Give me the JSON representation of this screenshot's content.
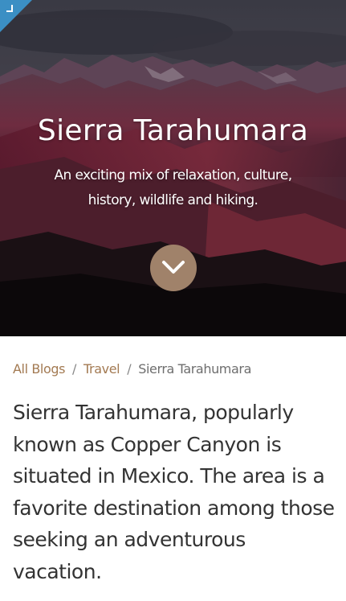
{
  "hero": {
    "title": "Sierra Tarahumara",
    "subtitle": "An exciting mix of relaxation, culture, history, wildlife and hiking.",
    "corner_icon": "arrow-corner-icon",
    "scroll_icon": "chevron-down-icon",
    "scroll_button_color": "#a0826a"
  },
  "breadcrumb": {
    "items": [
      {
        "label": "All Blogs",
        "link": true
      },
      {
        "label": "Travel",
        "link": true
      },
      {
        "label": "Sierra Tarahumara",
        "link": false
      }
    ],
    "separator": "/",
    "link_color": "#a37a52"
  },
  "article": {
    "intro": "Sierra Tarahumara, popularly known as Copper Canyon is situated in Mexico. The area is a favorite destination among those seeking an adventurous vacation."
  }
}
